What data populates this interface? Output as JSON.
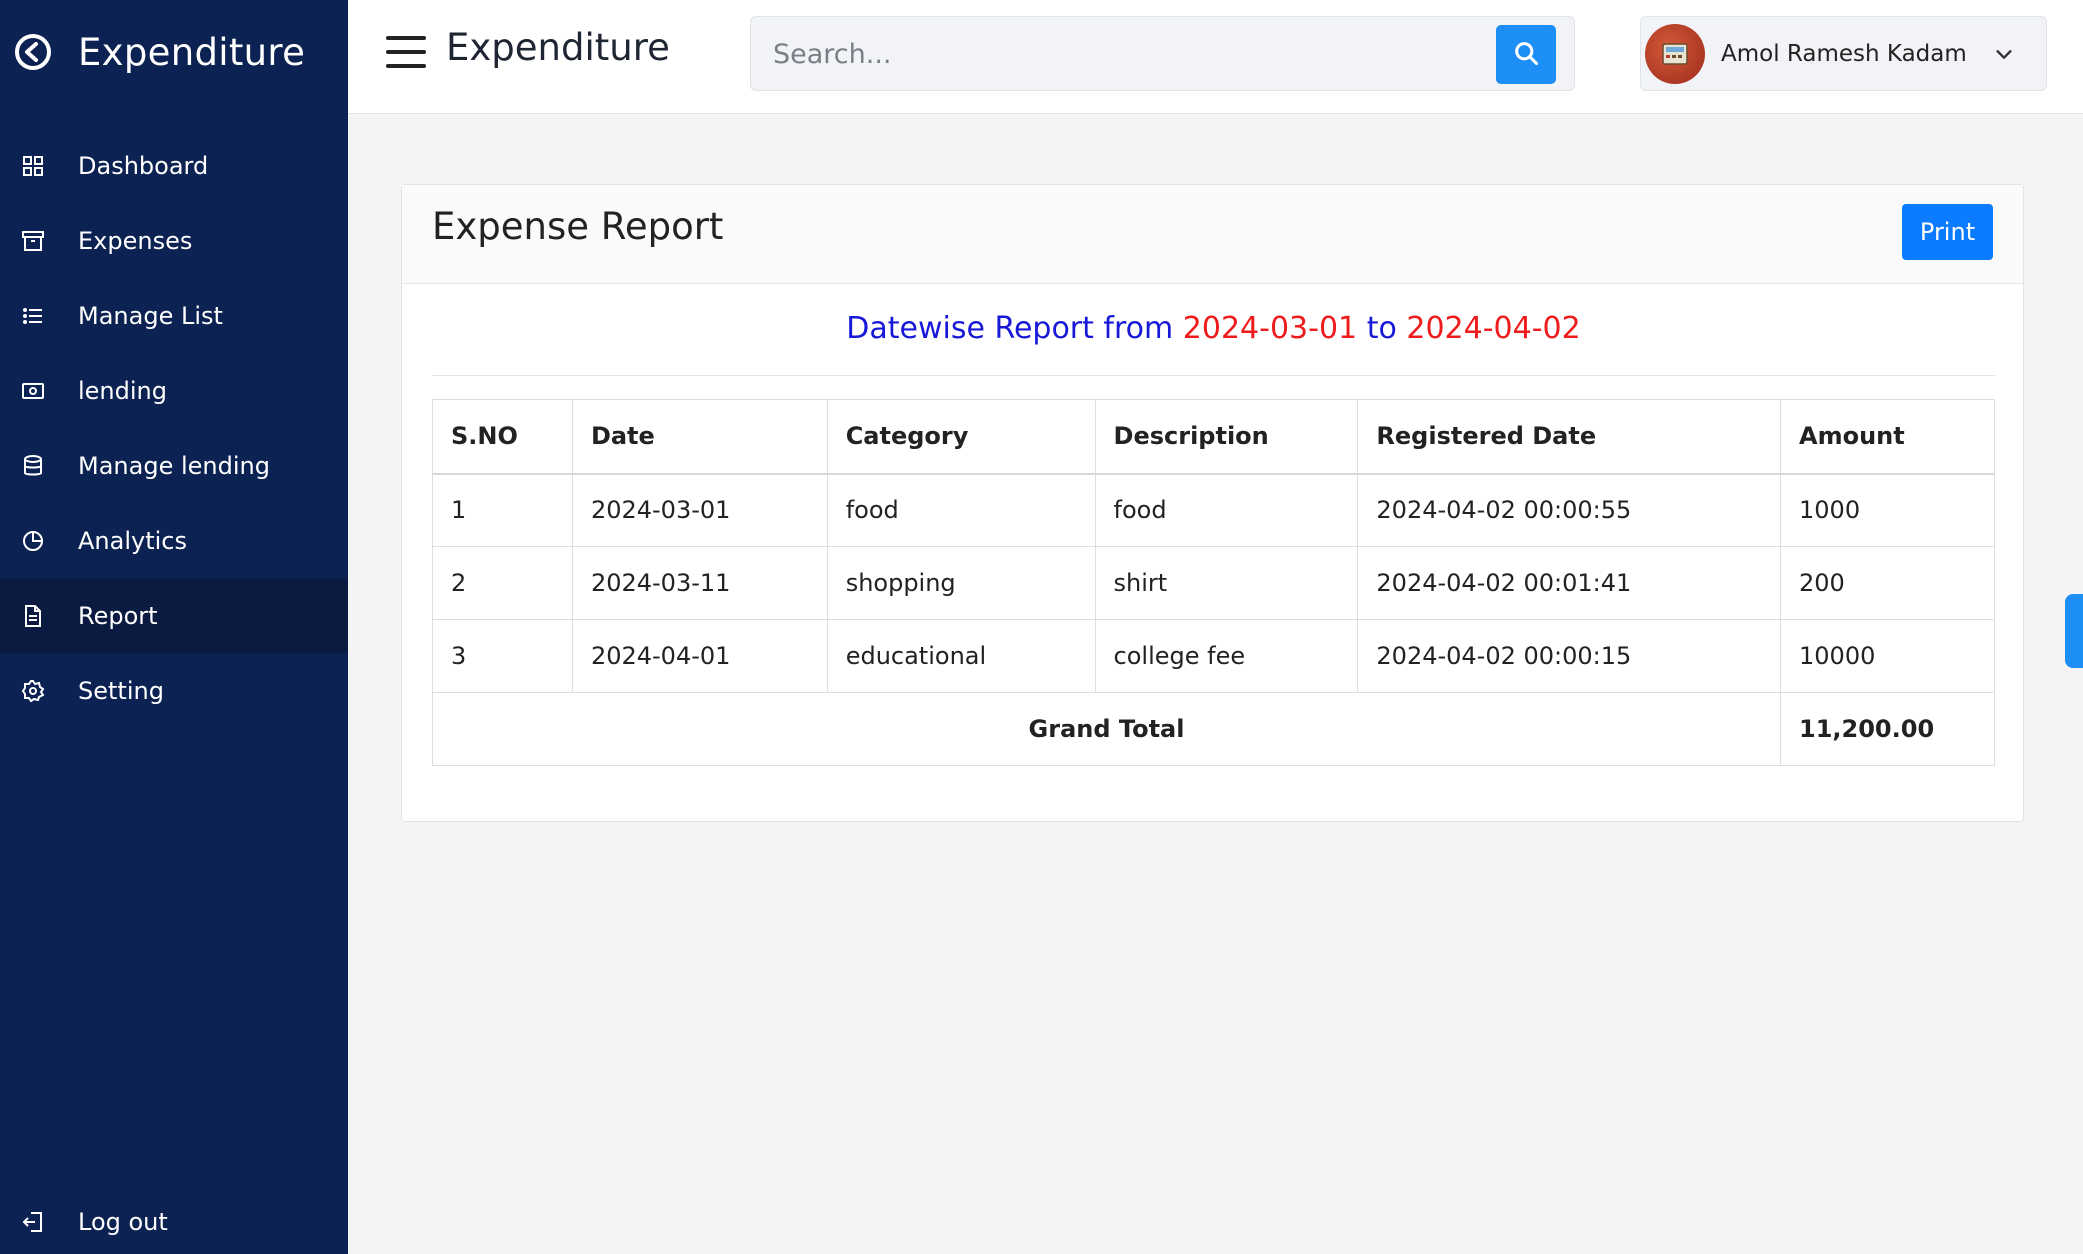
{
  "app": {
    "brand": "Expenditure",
    "page_title": "Expenditure"
  },
  "sidebar": {
    "items": [
      {
        "label": "Dashboard",
        "icon": "grid-icon"
      },
      {
        "label": "Expenses",
        "icon": "archive-icon"
      },
      {
        "label": "Manage List",
        "icon": "list-icon"
      },
      {
        "label": "lending",
        "icon": "money-icon"
      },
      {
        "label": "Manage lending",
        "icon": "database-icon"
      },
      {
        "label": "Analytics",
        "icon": "pie-chart-icon"
      },
      {
        "label": "Report",
        "icon": "document-icon",
        "active": true
      },
      {
        "label": "Setting",
        "icon": "gear-icon"
      }
    ],
    "logout_label": "Log out"
  },
  "search": {
    "placeholder": "Search..."
  },
  "user": {
    "name": "Amol Ramesh Kadam"
  },
  "report": {
    "card_title": "Expense Report",
    "print_label": "Print",
    "heading_prefix": "Datewise Report from",
    "from_date": "2024-03-01",
    "heading_middle": "to",
    "to_date": "2024-04-02",
    "columns": [
      "S.NO",
      "Date",
      "Category",
      "Description",
      "Registered Date",
      "Amount"
    ],
    "rows": [
      [
        "1",
        "2024-03-01",
        "food",
        "food",
        "2024-04-02 00:00:55",
        "1000"
      ],
      [
        "2",
        "2024-03-11",
        "shopping",
        "shirt",
        "2024-04-02 00:01:41",
        "200"
      ],
      [
        "3",
        "2024-04-01",
        "educational",
        "college fee",
        "2024-04-02 00:00:15",
        "10000"
      ]
    ],
    "grand_total_label": "Grand Total",
    "grand_total_value": "11,200.00"
  },
  "colors": {
    "sidebar": "#0c2252",
    "accent": "#1c8ef5",
    "heading_blue": "#1818d8",
    "heading_red": "#ee1c1c"
  }
}
